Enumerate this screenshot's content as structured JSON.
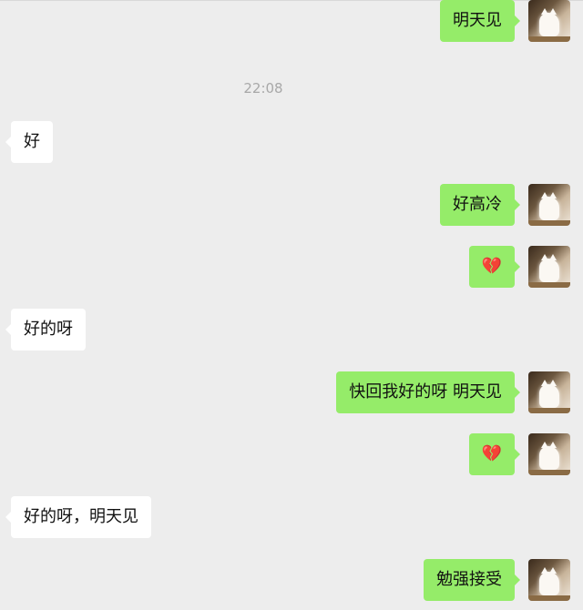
{
  "timestamp": "22:08",
  "messages": [
    {
      "side": "right",
      "text": "明天见"
    },
    {
      "side": "left",
      "text": "好"
    },
    {
      "side": "right",
      "text": "好高冷"
    },
    {
      "side": "right",
      "text": "💔",
      "emoji": "broken-heart"
    },
    {
      "side": "left",
      "text": "好的呀"
    },
    {
      "side": "right",
      "text": "快回我好的呀 明天见"
    },
    {
      "side": "right",
      "text": "💔",
      "emoji": "broken-heart"
    },
    {
      "side": "left",
      "text": "好的呀，明天见"
    },
    {
      "side": "right",
      "text": "勉强接受"
    }
  ],
  "colors": {
    "background": "#ededed",
    "sent_bubble": "#95ec69",
    "received_bubble": "#ffffff",
    "timestamp_text": "#a8a8a8"
  },
  "icons": {
    "avatar": "avatar-cat-photo",
    "emoji": "broken-heart"
  }
}
